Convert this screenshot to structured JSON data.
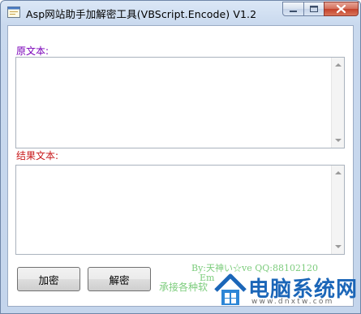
{
  "window": {
    "title": "Asp网站助手加解密工具(VBScript.Encode) V1.2"
  },
  "labels": {
    "source": "原文本:",
    "result": "结果文本:"
  },
  "fields": {
    "source_value": "",
    "result_value": ""
  },
  "buttons": {
    "encrypt": "加密",
    "decrypt": "解密"
  },
  "credits": {
    "by": "By:天神い☆ve QQ:88102120",
    "email": "Em",
    "more": "承接各种软"
  },
  "watermark": {
    "name": "电脑系统网",
    "url": "www.dnxtw.com"
  },
  "colors": {
    "source_label": "#7a00b8",
    "result_label": "#c8181a",
    "credit_text": "#7ccc7c",
    "watermark_blue": "#1b66b8"
  },
  "icons": {
    "app": "app-window-icon",
    "minimize": "minimize-icon",
    "maximize": "maximize-icon",
    "close": "close-icon"
  }
}
